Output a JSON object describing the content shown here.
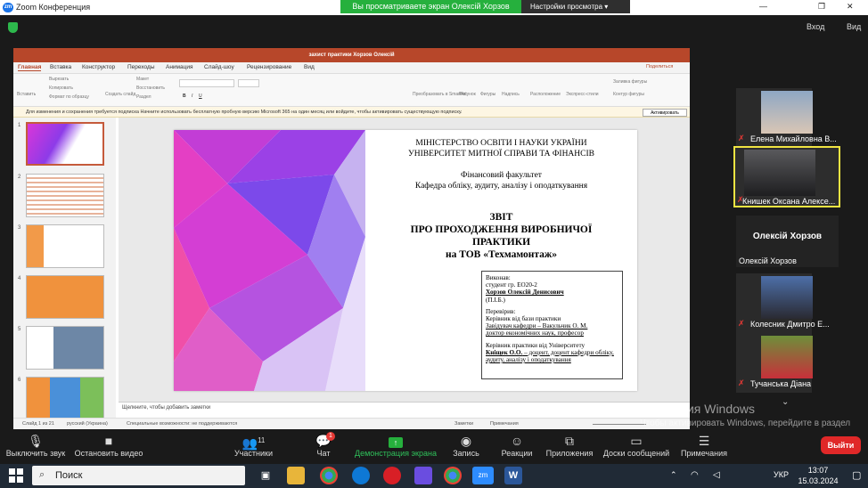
{
  "window": {
    "app_title": "Zoom Конференция",
    "zoom_badge": "zm"
  },
  "share_banner": {
    "text": "Вы просматриваете экран Олексій Хорзов",
    "view_options": "Настройки просмотра ▾"
  },
  "window_controls": {
    "minimize": "—",
    "restore": "❐",
    "close": "✕"
  },
  "top_right": {
    "enter": "Вход",
    "view": "Вид"
  },
  "powerpoint": {
    "file_title": "захист практики Хорзов Олексій",
    "tabs": [
      "Главная",
      "Вставка",
      "Конструктор",
      "Переходы",
      "Анимация",
      "Слайд-шоу",
      "Рецензирование",
      "Вид"
    ],
    "share_btn": "Поделиться",
    "ribbon": {
      "paste": "Вставить",
      "cut": "Вырезать",
      "copy": "Копировать",
      "format_painter": "Формат по образцу",
      "new_slide": "Создать слайд",
      "layout": "Макет",
      "reset": "Восстановить",
      "section": "Раздел",
      "convert": "Преобразовать в SmartArt",
      "picture": "Рисунок",
      "shapes": "Фигуры",
      "textbox": "Надпись",
      "arrange": "Расположение",
      "quick_styles": "Экспресс-стили",
      "fill": "Заливка фигуры",
      "outline": "Контур фигуры"
    },
    "warning": "Для изменения и сохранения требуется подписка  Начните использовать бесплатную пробную версию Microsoft 365 на один месяц или войдите, чтобы активировать существующую подписку.",
    "activate_btn": "Активировать",
    "thumb_numbers": [
      "1",
      "2",
      "3",
      "4",
      "5",
      "6"
    ],
    "notes_placeholder": "Щелкните, чтобы добавить заметки",
    "status": {
      "slide_of": "Слайд 1 из 21",
      "language": "русский (Украина)",
      "accessibility": "Специальные возможности: не поддерживаются",
      "notes": "Заметки",
      "comments": "Примечания"
    }
  },
  "slide": {
    "ministry": "МІНІСТЕРСТВО ОСВІТИ І НАУКИ УКРАЇНИ",
    "university": "УНІВЕРСИТЕТ МИТНОЇ СПРАВИ ТА ФІНАНСІВ",
    "faculty": "Фінансовий факультет",
    "department": "Кафедра обліку, аудиту, аналізу і оподаткування",
    "report": "ЗВІТ",
    "report_line2": "ПРО ПРОХОДЖЕННЯ ВИРОБНИЧОЇ",
    "report_line3": "ПРАКТИКИ",
    "report_line4": "на ТОВ «Техмамонтаж»",
    "box": {
      "done": "Виконав:",
      "student": "студент гр. ЕО20-2",
      "student_name": "Хорзов Олексій Денисович",
      "pib": "(П.І.Б.)",
      "checked": "Перевірив:",
      "base_head": "Керівник від бази практики",
      "base_name": "Завідувач кафедри – Вакульчик О. М.",
      "base_title": "доктор економічних наук, професор",
      "uni_head": "Керівник практики від Університету",
      "uni_name": "Кніщек О.О.",
      "uni_title": " – доцент, доцент кафедри обліку, аудиту, аналізу і оподаткування"
    }
  },
  "participants": [
    {
      "name": "Елена Михайловна В...",
      "muted": true
    },
    {
      "name": "Книшек Оксана Алексе...",
      "muted": true,
      "active": true
    },
    {
      "name": "Олексій Хорзов",
      "label": "Олексій Хорзов",
      "muted": false
    },
    {
      "name": "Колесник Дмитро Е...",
      "muted": true
    },
    {
      "name": "Тучанська Діана",
      "muted": true
    }
  ],
  "toolbar": {
    "mute": "Выключить звук",
    "video": "Остановить видео",
    "participants": "Участники",
    "participants_count": "11",
    "chat": "Чат",
    "chat_badge": "1",
    "share": "Демонстрация экрана",
    "record": "Запись",
    "reactions": "Реакции",
    "apps": "Приложения",
    "whiteboards": "Доски сообщений",
    "notes": "Примечания",
    "leave": "Выйти"
  },
  "watermark": {
    "title": "Активация Windows",
    "text": "Чтобы активировать Windows, перейдите в раздел \"Параметры\"."
  },
  "taskbar": {
    "search": "Поиск",
    "lang": "УКР",
    "time": "13:07",
    "date": "15.03.2024"
  },
  "colors": {
    "zoom_green": "#26b03d",
    "pp_red": "#b7472a",
    "leave_red": "#e02828",
    "active_border": "#f0e442"
  }
}
